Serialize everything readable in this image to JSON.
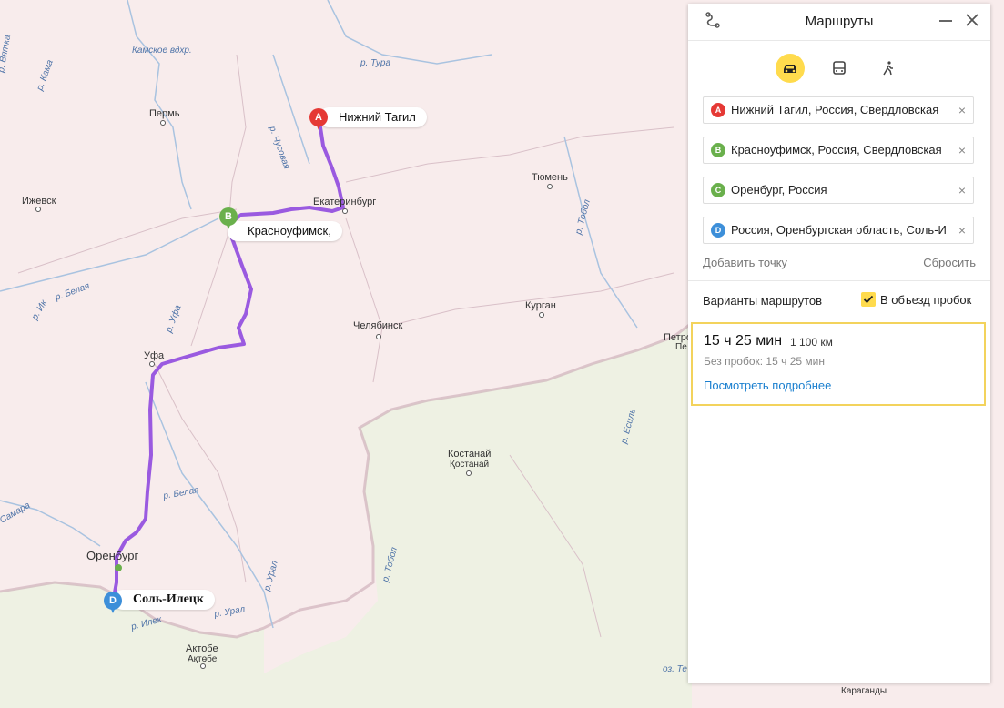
{
  "map": {
    "cities": [
      {
        "name": "Пермь"
      },
      {
        "name": "Ижевск"
      },
      {
        "name": "Екатеринбург"
      },
      {
        "name": "Тюмень"
      },
      {
        "name": "Уфа"
      },
      {
        "name": "Челябинск"
      },
      {
        "name": "Курган"
      },
      {
        "name": "Оренбург"
      },
      {
        "name": "Костанай"
      },
      {
        "name": "Қостанай"
      },
      {
        "name": "Актобе"
      },
      {
        "name": "Ақтөбе"
      },
      {
        "name": "Петро"
      },
      {
        "name": "Пе"
      },
      {
        "name": "Караганды"
      }
    ],
    "rivers": [
      {
        "name": "Камское вдхр."
      },
      {
        "name": "р. Тура"
      },
      {
        "name": "р. Чусовая"
      },
      {
        "name": "р. Вятка"
      },
      {
        "name": "р. Кама"
      },
      {
        "name": "р. Тобол"
      },
      {
        "name": "р. Белая"
      },
      {
        "name": "р. Уфа"
      },
      {
        "name": "р. Ик"
      },
      {
        "name": "р. Урал"
      },
      {
        "name": "р. Илек"
      },
      {
        "name": "р. Есиль"
      },
      {
        "name": "Самара"
      },
      {
        "name": "оз. Те"
      }
    ],
    "pins": [
      {
        "letter": "A",
        "label": "Нижний Тагил",
        "color": "#e53935"
      },
      {
        "letter": "B",
        "label": "Красноуфимск,",
        "color": "#6ab04c"
      },
      {
        "letter": "D",
        "label": "Соль-Илецк",
        "color": "#3d8fd9"
      }
    ],
    "route_color": "#9a5ae0"
  },
  "panel": {
    "title": "Маршруты",
    "icons": {
      "routes": "route-icon",
      "minimize": "minimize-icon",
      "close": "close-icon"
    },
    "modes": [
      {
        "name": "car",
        "icon": "car-icon",
        "active": true
      },
      {
        "name": "transit",
        "icon": "bus-icon",
        "active": false
      },
      {
        "name": "walk",
        "icon": "pedestrian-icon",
        "active": false
      }
    ],
    "waypoints": [
      {
        "letter": "A",
        "text": "Нижний Тагил, Россия, Свердловская",
        "color": "#e53935"
      },
      {
        "letter": "B",
        "text": "Красноуфимск, Россия, Свердловская",
        "color": "#6ab04c"
      },
      {
        "letter": "C",
        "text": "Оренбург, Россия",
        "color": "#6ab04c"
      },
      {
        "letter": "D",
        "text": "Россия, Оренбургская область, Соль-И",
        "color": "#3d8fd9"
      }
    ],
    "add_point": "Добавить точку",
    "reset": "Сбросить",
    "variants_label": "Варианты маршрутов",
    "avoid_traffic": "В объезд пробок",
    "route": {
      "time": "15 ч 25 мин",
      "distance": "1 100 км",
      "no_traffic": "Без пробок: 15 ч 25 мин",
      "details": "Посмотреть подробнее"
    },
    "accent": "#ffdb4d",
    "link_color": "#1a7fcf"
  }
}
